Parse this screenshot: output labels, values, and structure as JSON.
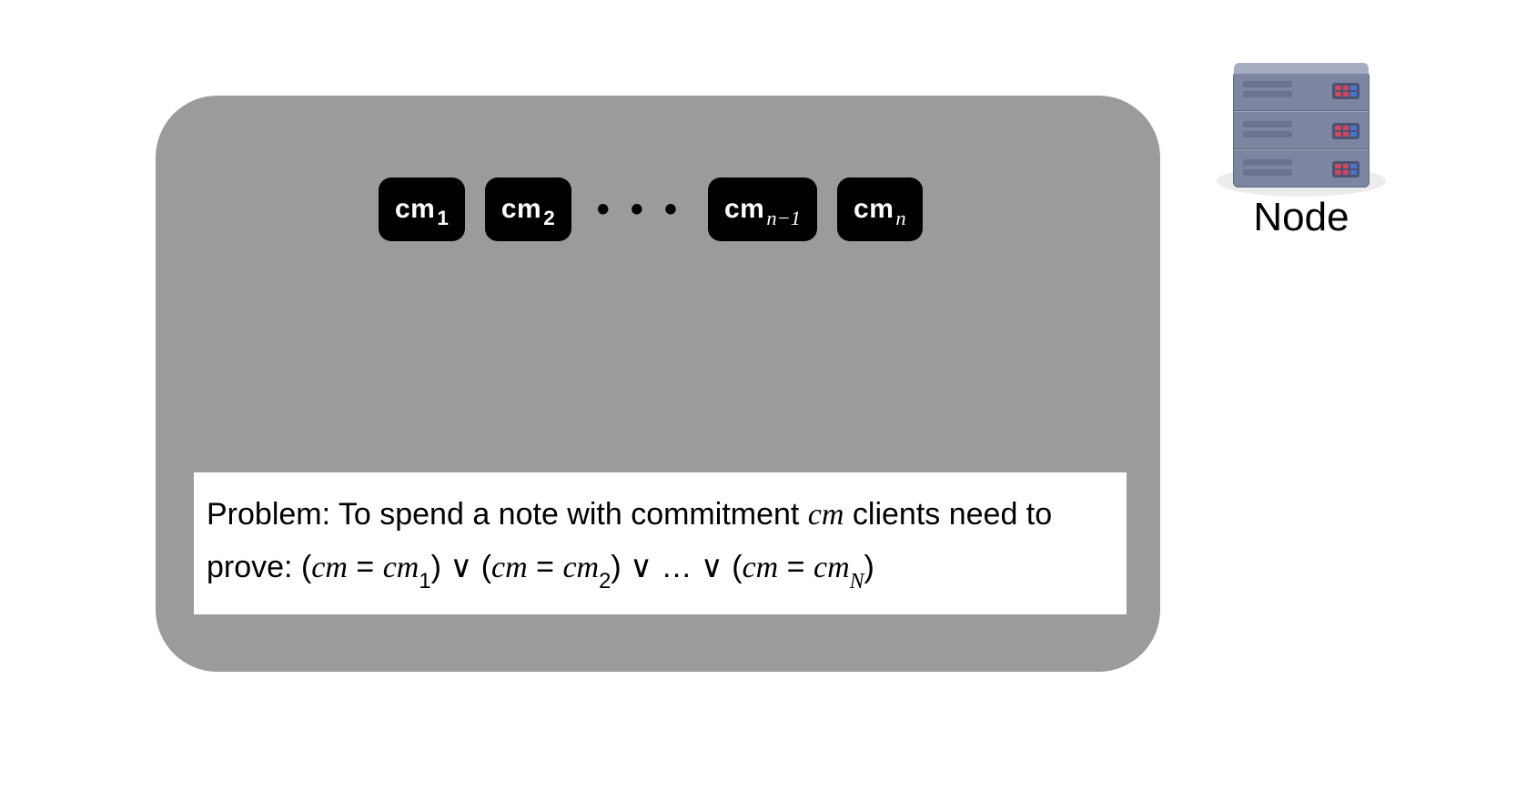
{
  "commitments": {
    "base": "cm",
    "items": [
      {
        "sub": "1",
        "italic": false
      },
      {
        "sub": "2",
        "italic": false
      },
      {
        "sub": "n−1",
        "italic": true
      },
      {
        "sub": "n",
        "italic": true
      }
    ],
    "ellipsis": "• • •"
  },
  "problem": {
    "prefix": "Problem: To spend a note with commitment ",
    "cm_var": "cm",
    "mid": " clients need to prove: ",
    "disjuncts": [
      {
        "sub": "1"
      },
      {
        "sub": "2"
      }
    ],
    "or_symbol": " ∨ ",
    "ellipsis": " … ",
    "final_sub": "N",
    "eq": " = ",
    "lparen": "(",
    "rparen": ")"
  },
  "node": {
    "label": "Node",
    "led_colors": [
      "#d6455b",
      "#d6455b",
      "#4a74d4",
      "#d6455b",
      "#d6455b",
      "#4a74d4"
    ]
  }
}
